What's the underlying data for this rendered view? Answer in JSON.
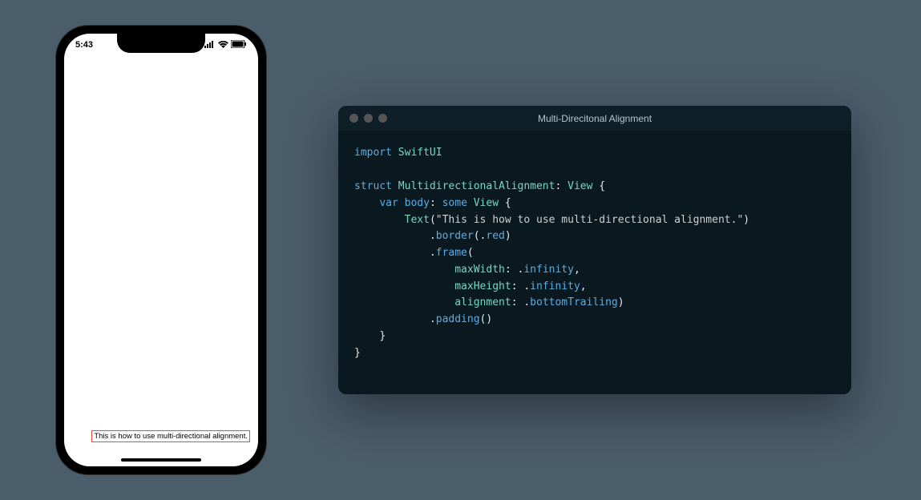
{
  "phone": {
    "status_time": "5:43",
    "content_text": "This is how to use multi-directional alignment."
  },
  "window": {
    "title": "Multi-Direcitonal Alignment"
  },
  "code": {
    "l1_import": "import",
    "l1_module": "SwiftUI",
    "l2_struct": "struct",
    "l2_name": "MultidirectionalAlignment",
    "l2_proto": "View",
    "l3_var": "var",
    "l3_body": "body",
    "l3_some": "some",
    "l3_view": "View",
    "l4_text": "Text",
    "l4_string": "\"This is how to use multi-directional alignment.\"",
    "l5_border": "border",
    "l5_red": "red",
    "l6_frame": "frame",
    "l7_maxwidth": "maxWidth",
    "l7_infinity": "infinity",
    "l8_maxheight": "maxHeight",
    "l8_infinity": "infinity",
    "l9_alignment": "alignment",
    "l9_bottomtrailing": "bottomTrailing",
    "l10_padding": "padding"
  }
}
